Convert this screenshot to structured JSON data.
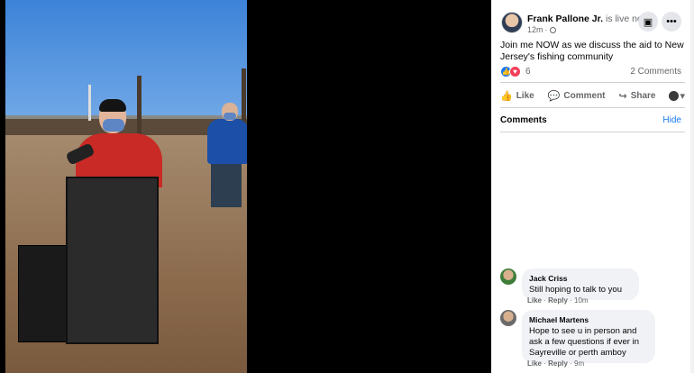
{
  "post": {
    "author": "Frank Pallone Jr.",
    "status": " is live now.",
    "time": "12m",
    "privacy_icon": "globe-icon",
    "text": "Join me NOW as we discuss the aid to New Jersey's fishing community",
    "reaction_count": "6",
    "comments_count": "2 Comments"
  },
  "actions": {
    "like": "Like",
    "comment": "Comment",
    "share": "Share"
  },
  "comments_section": {
    "title": "Comments",
    "hide": "Hide"
  },
  "comments": [
    {
      "name": "Jack Criss",
      "text": "Still hoping to talk to you",
      "like": "Like",
      "reply": "Reply",
      "time": "10m"
    },
    {
      "name": "Michael Martens",
      "text": "Hope to see u in person and ask a few questions if ever in Sayreville or perth amboy",
      "like": "Like",
      "reply": "Reply",
      "time": "9m"
    }
  ],
  "colors": {
    "accent": "#1877f2",
    "love": "#f33e58",
    "muted": "#65676b",
    "bubble": "#f0f2f5"
  }
}
